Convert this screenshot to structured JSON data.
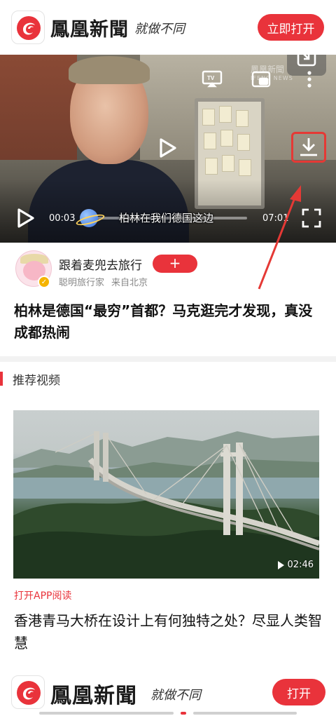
{
  "header": {
    "brand": "鳳凰新聞",
    "slogan": "就做不同",
    "open_label": "立即打开"
  },
  "player": {
    "watermark": "鳳凰新聞",
    "watermark_sub": "IFENG NEWS",
    "current_time": "00:03",
    "total_time": "07:01",
    "progress": 0.05,
    "subtitle": "柏林在我们德国这边",
    "icons": [
      "shrink-icon",
      "tv-cast-icon",
      "pip-icon",
      "more-icon",
      "play-icon",
      "download-icon",
      "fullscreen-icon"
    ]
  },
  "author": {
    "name": "跟着麦兜去旅行",
    "follow_label": "+",
    "tag": "聪明旅行家",
    "location": "来自北京"
  },
  "article": {
    "title": "柏林是德国“最穷”首都？马克逛完才发现，真没成都热闹"
  },
  "recommend": {
    "section_title": "推荐视频",
    "item": {
      "duration": "02:46",
      "tag": "打开APP阅读",
      "title": "香港青马大桥在设计上有何独特之处？尽显人类智慧"
    }
  },
  "bottom_banner": {
    "brand": "鳳凰新聞",
    "slogan": "就做不同",
    "open_label": "打开"
  },
  "colors": {
    "accent": "#e9333b",
    "annotation": "#e53935"
  }
}
